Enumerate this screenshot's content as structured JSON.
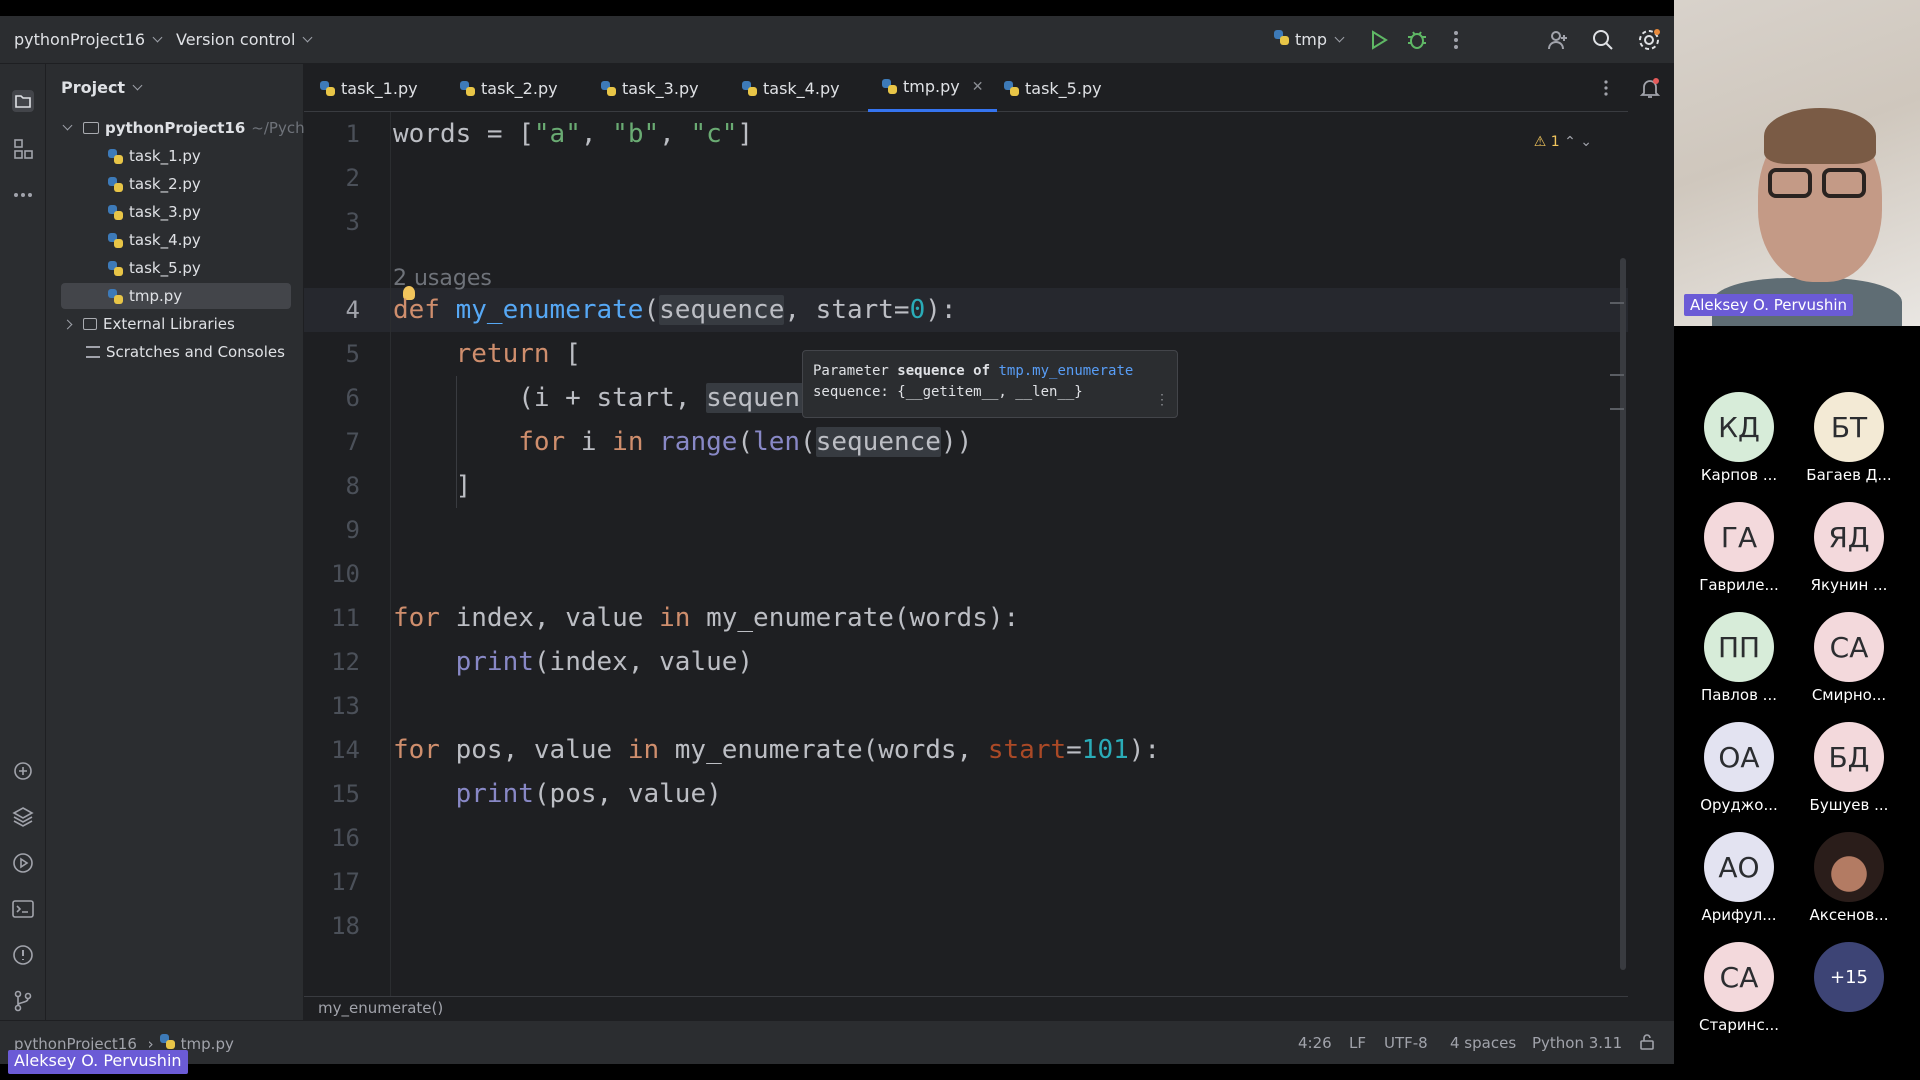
{
  "topbar": {
    "project": "pythonProject16",
    "vcs": "Version control",
    "run_config": "tmp"
  },
  "project_panel": {
    "title": "Project",
    "root": "pythonProject16",
    "root_path": "~/Pycharr",
    "files": [
      "task_1.py",
      "task_2.py",
      "task_3.py",
      "task_4.py",
      "task_5.py",
      "tmp.py"
    ],
    "external": "External Libraries",
    "scratches": "Scratches and Consoles"
  },
  "tabs": [
    {
      "label": "task_1.py"
    },
    {
      "label": "task_2.py"
    },
    {
      "label": "task_3.py"
    },
    {
      "label": "task_4.py"
    },
    {
      "label": "tmp.py",
      "active": true
    },
    {
      "label": "task_5.py"
    }
  ],
  "editor": {
    "line_numbers": [
      "1",
      "2",
      "3",
      "4",
      "5",
      "6",
      "7",
      "8",
      "9",
      "10",
      "11",
      "12",
      "13",
      "14",
      "15",
      "16",
      "17",
      "18"
    ],
    "current_line": "4",
    "usages_hint": "2 usages",
    "warnings": "1",
    "tooltip": {
      "prefix": "Parameter",
      "param": "sequence",
      "of": "of",
      "target": "tmp.my_enumerate",
      "line2": "sequence: {__getitem__, __len__}"
    },
    "breadcrumb": "my_enumerate()"
  },
  "statusbar": {
    "path_project": "pythonProject16",
    "path_file": "tmp.py",
    "position": "4:26",
    "line_sep": "LF",
    "encoding": "UTF-8",
    "indent": "4 spaces",
    "interpreter": "Python 3.11"
  },
  "video": {
    "speaker_name": "Aleksey O. Pervushin",
    "screen_share_label": "Aleksey O. Pervushin"
  },
  "participants": [
    {
      "initials": "КД",
      "name": "Карпов ...",
      "color": "#d7ecd9"
    },
    {
      "initials": "БТ",
      "name": "Багаев Д...",
      "color": "#f3ead5"
    },
    {
      "initials": "ГА",
      "name": "Гавриле...",
      "color": "#f3d9dc"
    },
    {
      "initials": "ЯД",
      "name": "Якунин ...",
      "color": "#f3d9dc"
    },
    {
      "initials": "ПП",
      "name": "Павлов ...",
      "color": "#d7ecd9"
    },
    {
      "initials": "СА",
      "name": "Смирно...",
      "color": "#f3d9dc"
    },
    {
      "initials": "ОА",
      "name": "Оруджо...",
      "color": "#e3e3f1"
    },
    {
      "initials": "БД",
      "name": "Бушуев ...",
      "color": "#f3d9dc"
    },
    {
      "initials": "АО",
      "name": "Арифул...",
      "color": "#e3e3f1"
    },
    {
      "initials": "",
      "name": "Аксенов...",
      "color": "#3a2a26"
    },
    {
      "initials": "СА",
      "name": "Старинс...",
      "color": "#f3d9dc"
    },
    {
      "initials": "+15",
      "name": "",
      "color": "#3d4475"
    }
  ]
}
